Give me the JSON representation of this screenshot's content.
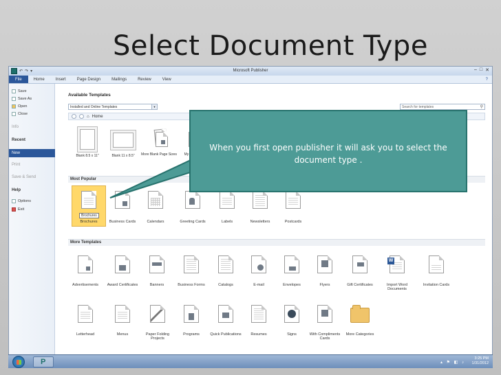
{
  "slide": {
    "title": "Select Document Type"
  },
  "window": {
    "app_title": "Microsoft Publisher",
    "quick_access": [
      "↶",
      "↷",
      "▾"
    ],
    "controls": [
      "–",
      "□",
      "✕"
    ]
  },
  "ribbon": {
    "tabs": [
      "File",
      "Home",
      "Insert",
      "Page Design",
      "Mailings",
      "Review",
      "View"
    ],
    "help": "?"
  },
  "leftnav": {
    "save": "Save",
    "save_as": "Save As",
    "open": "Open",
    "close": "Close",
    "info": "Info",
    "recent": "Recent",
    "new": "New",
    "print": "Print",
    "save_send": "Save & Send",
    "help": "Help",
    "options": "Options",
    "exit": "Exit"
  },
  "main": {
    "available_templates": "Available Templates",
    "source_select": "Installed and Online Templates",
    "search_placeholder": "Search for templates",
    "nav_home": "Home",
    "blank_tiles": [
      "Blank 8.5 x 11\"",
      "Blank 11 x 8.5\"",
      "More Blank Page Sizes",
      "My Templates"
    ],
    "most_popular": "Most Popular",
    "popular_items": [
      "Brochures",
      "Business Cards",
      "Calendars",
      "Greeting Cards",
      "Labels",
      "Newsletters",
      "Postcards"
    ],
    "brochure_caption": "Brochures",
    "more_templates": "More Templates",
    "more_row1": [
      "Advertisements",
      "Award Certificates",
      "Banners",
      "Business Forms",
      "Catalogs",
      "E-mail",
      "Envelopes",
      "Flyers",
      "Gift Certificates",
      "Import Word Documents",
      "Invitation Cards"
    ],
    "more_row2": [
      "Letterhead",
      "Menus",
      "Paper Folding Projects",
      "Programs",
      "Quick Publications",
      "Resumes",
      "Signs",
      "With Compliments Cards",
      "More Categories"
    ]
  },
  "callout": {
    "text": "When you first open publisher it will ask you to select the document type ."
  },
  "taskbar": {
    "time": "3:25 PM",
    "date": "1/31/2012"
  }
}
